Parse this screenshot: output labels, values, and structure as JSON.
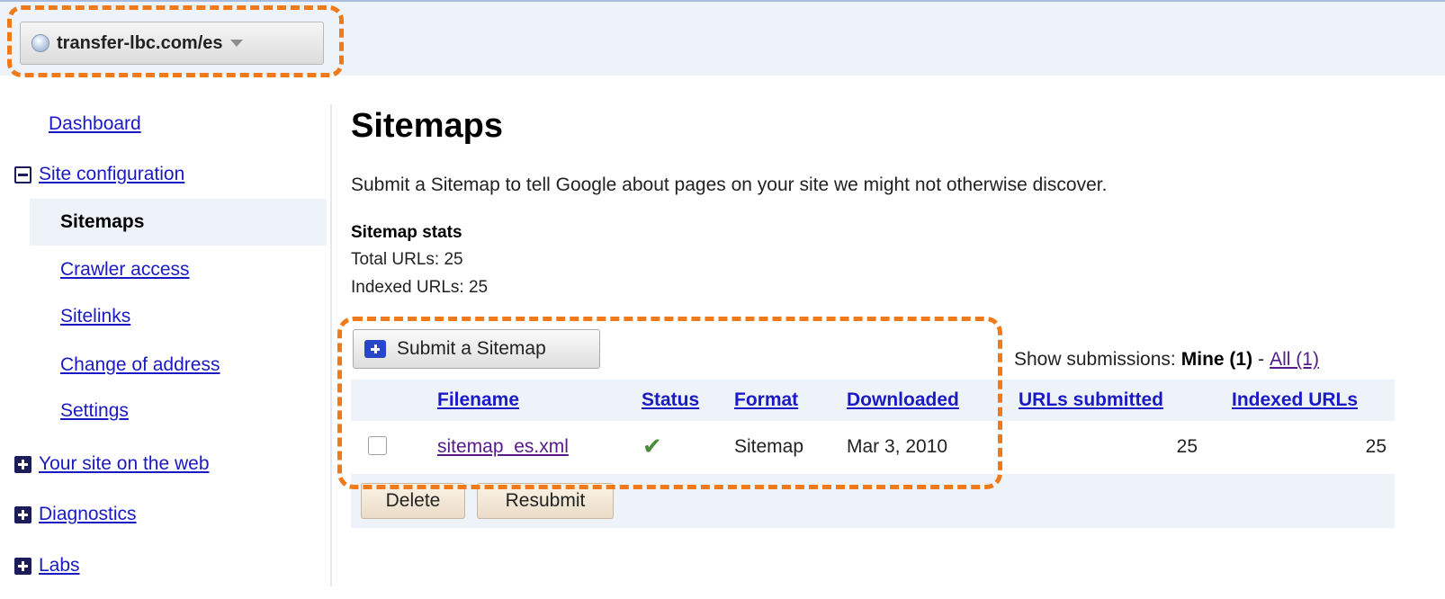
{
  "header": {
    "site": "transfer-lbc.com/es"
  },
  "sidebar": {
    "items": [
      {
        "label": "Dashboard"
      },
      {
        "label": "Site configuration"
      },
      {
        "label": "Sitemaps"
      },
      {
        "label": "Crawler access"
      },
      {
        "label": "Sitelinks"
      },
      {
        "label": "Change of address"
      },
      {
        "label": "Settings"
      },
      {
        "label": "Your site on the web"
      },
      {
        "label": "Diagnostics"
      },
      {
        "label": "Labs"
      }
    ]
  },
  "main": {
    "title": "Sitemaps",
    "intro": "Submit a Sitemap to tell Google about pages on your site we might not otherwise discover.",
    "stats": {
      "title": "Sitemap stats",
      "total": "Total URLs: 25",
      "indexed": "Indexed URLs: 25"
    },
    "submit_label": "Submit a Sitemap",
    "show_submissions": {
      "label": "Show submissions:",
      "mine": "Mine (1)",
      "sep": "-",
      "all": "All (1)"
    },
    "table": {
      "columns": [
        "Filename",
        "Status",
        "Format",
        "Downloaded",
        "URLs submitted",
        "Indexed URLs"
      ],
      "rows": [
        {
          "filename": "sitemap_es.xml",
          "status": "✔",
          "format": "Sitemap",
          "downloaded": "Mar 3, 2010",
          "urls_submitted": "25",
          "indexed_urls": "25"
        }
      ]
    },
    "actions": {
      "delete": "Delete",
      "resubmit": "Resubmit"
    }
  },
  "colors": {
    "link": "#1a1ac4",
    "visited": "#551a8b",
    "highlight_dash": "#f07a1a",
    "panel_bg": "#eef2f9"
  }
}
